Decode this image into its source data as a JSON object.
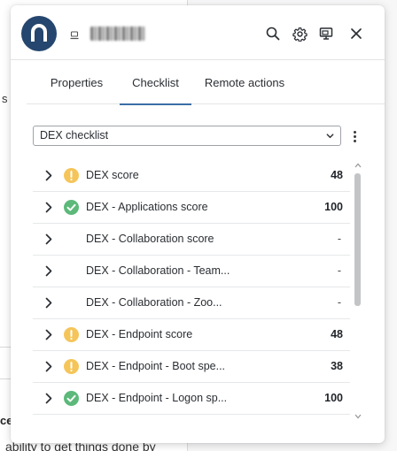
{
  "background": {
    "text_fragment_1": "s n",
    "text_fragment_2": "ce",
    "text_fragment_3": "ability to get things done by"
  },
  "header": {
    "logo_letter": "n",
    "device_name_redacted": true,
    "icons": [
      "search-icon",
      "gear-icon",
      "remote-screen-icon",
      "close-icon"
    ]
  },
  "tabs": [
    {
      "label": "Properties",
      "active": false
    },
    {
      "label": "Checklist",
      "active": true
    },
    {
      "label": "Remote actions",
      "active": false
    }
  ],
  "checklist_select": {
    "value": "DEX checklist"
  },
  "checklist": [
    {
      "name": "DEX score",
      "status": "warning",
      "value": "48"
    },
    {
      "name": "DEX - Applications score",
      "status": "ok",
      "value": "100"
    },
    {
      "name": "DEX - Collaboration score",
      "status": "none",
      "value": "-"
    },
    {
      "name": "DEX - Collaboration - Team...",
      "status": "none",
      "value": "-"
    },
    {
      "name": "DEX - Collaboration - Zoo...",
      "status": "none",
      "value": "-"
    },
    {
      "name": "DEX - Endpoint score",
      "status": "warning",
      "value": "48"
    },
    {
      "name": "DEX - Endpoint - Boot spe...",
      "status": "warning",
      "value": "38"
    },
    {
      "name": "DEX - Endpoint - Logon sp...",
      "status": "ok",
      "value": "100"
    }
  ],
  "colors": {
    "accent": "#3a6ea5",
    "logo_bg": "#25466e",
    "warning": "#f5c55a",
    "ok": "#5cb97a"
  }
}
